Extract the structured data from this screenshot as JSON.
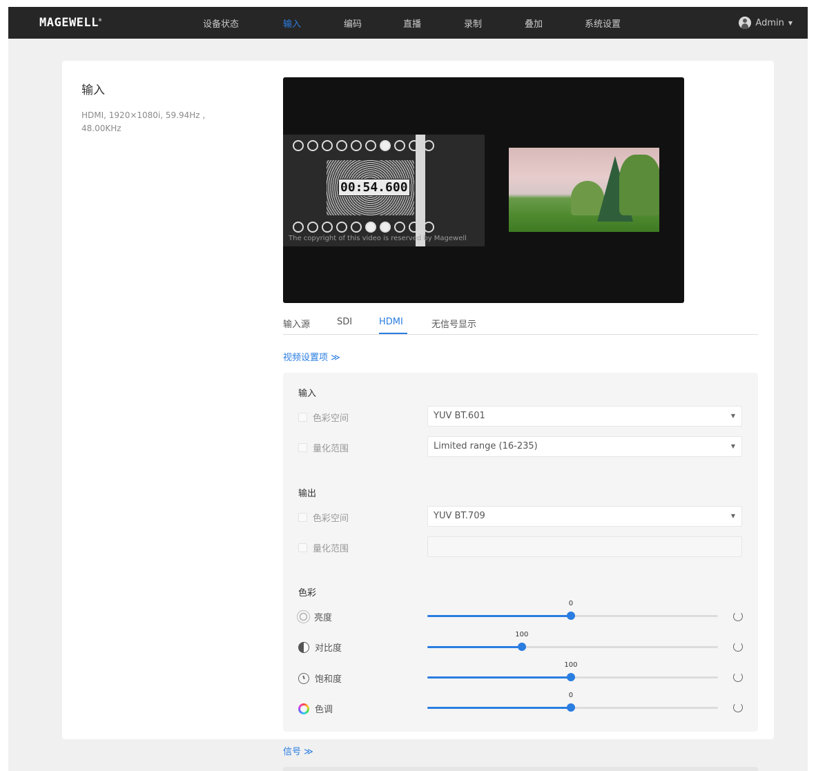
{
  "navbar": {
    "logo": "MAGEWELL",
    "logo_mark": "®",
    "items": [
      {
        "label": "设备状态",
        "active": false
      },
      {
        "label": "输入",
        "active": true
      },
      {
        "label": "编码",
        "active": false
      },
      {
        "label": "直播",
        "active": false
      },
      {
        "label": "录制",
        "active": false
      },
      {
        "label": "叠加",
        "active": false
      },
      {
        "label": "系统设置",
        "active": false
      }
    ],
    "user": "Admin"
  },
  "sidebar": {
    "title": "输入",
    "info": "HDMI, 1920×1080i, 59.94Hz , 48.00KHz"
  },
  "preview": {
    "timecode": "00:54.600",
    "copyright": "The copyright of this video is reserved by Magewell"
  },
  "tabs": [
    {
      "label": "输入源",
      "active": false
    },
    {
      "label": "SDI",
      "active": false
    },
    {
      "label": "HDMI",
      "active": true
    },
    {
      "label": "无信号显示",
      "active": false
    }
  ],
  "video_settings": {
    "link": "视频设置项",
    "input": {
      "heading": "输入",
      "color_space": {
        "label": "色彩空间",
        "value": "YUV BT.601"
      },
      "quant_range": {
        "label": "量化范围",
        "value": "Limited range (16-235)"
      }
    },
    "output": {
      "heading": "输出",
      "color_space": {
        "label": "色彩空间",
        "value": "YUV BT.709"
      },
      "quant_range": {
        "label": "量化范围",
        "value": ""
      }
    },
    "color": {
      "heading": "色彩",
      "brightness": {
        "label": "亮度",
        "value": "0",
        "fraction": 0.494
      },
      "contrast": {
        "label": "对比度",
        "value": "100",
        "fraction": 0.325
      },
      "saturation": {
        "label": "饱和度",
        "value": "100",
        "fraction": 0.494
      },
      "hue": {
        "label": "色调",
        "value": "0",
        "fraction": 0.494
      }
    }
  },
  "signal": {
    "link": "信号"
  },
  "colors": {
    "accent": "#2a7de1",
    "navbar": "#262626",
    "page_bg": "#f0f0f0"
  }
}
